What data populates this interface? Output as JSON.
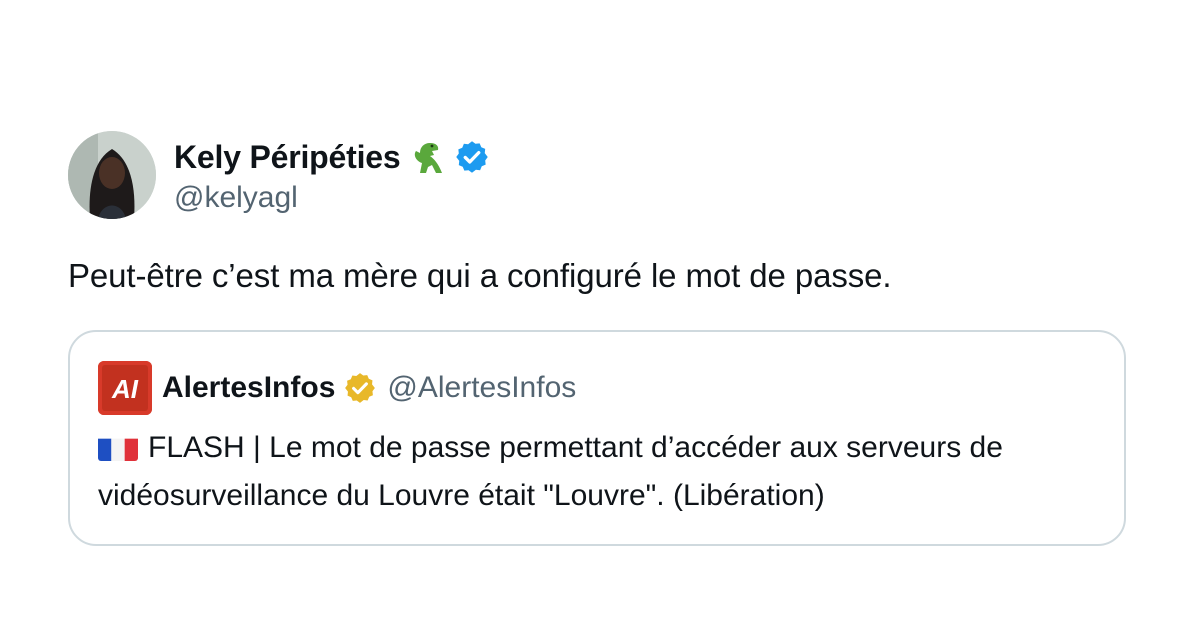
{
  "author": {
    "display_name": "Kely Péripéties",
    "handle": "@kelyagl",
    "emoji_icon": "t-rex-emoji-icon",
    "verified_icon": "verified-blue-badge-icon",
    "verified_color": "#1d9bf0"
  },
  "tweet": {
    "text": "Peut-être c’est ma mère qui a configuré le mot de passe."
  },
  "quoted": {
    "display_name": "AlertesInfos",
    "handle": "@AlertesInfos",
    "logo_icon": "alertesinfos-logo-icon",
    "logo_text": "AI",
    "badge_icon": "verified-gold-badge-icon",
    "badge_color": "#e8b829",
    "flag_icon": "france-flag-icon",
    "text": "FLASH | Le mot de passe permettant d’accéder aux serveurs de vidéosurveillance du Louvre était \"Louvre\". (Libération)"
  },
  "colors": {
    "text": "#0f1419",
    "secondary": "#536471",
    "border": "#cfd9de",
    "logo_red": "#d83a2a"
  }
}
